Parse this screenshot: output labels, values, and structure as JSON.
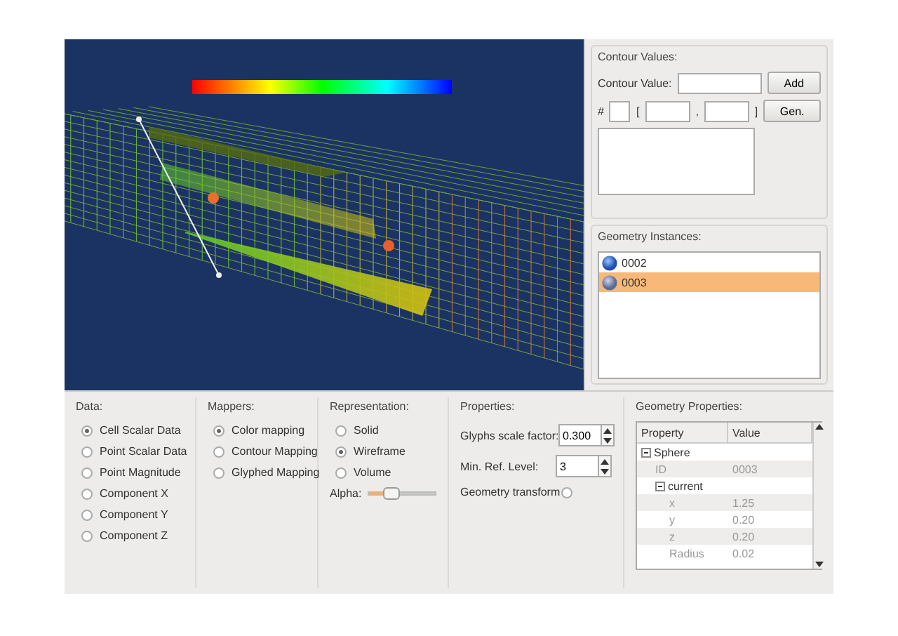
{
  "contour_values": {
    "title": "Contour Values:",
    "value_label": "Contour Value:",
    "add_button": "Add",
    "count_label": "#",
    "range_open": "[",
    "range_separator": ",",
    "range_close": "]",
    "gen_button": "Gen."
  },
  "geometry_instances": {
    "title": "Geometry Instances:",
    "items": [
      {
        "label": "0002",
        "selected": false
      },
      {
        "label": "0003",
        "selected": true
      }
    ]
  },
  "data": {
    "title": "Data:",
    "options": [
      {
        "label": "Cell Scalar Data",
        "selected": true
      },
      {
        "label": "Point Scalar Data",
        "selected": false
      },
      {
        "label": "Point Magnitude",
        "selected": false
      },
      {
        "label": "Component X",
        "selected": false
      },
      {
        "label": "Component Y",
        "selected": false
      },
      {
        "label": "Component Z",
        "selected": false
      }
    ]
  },
  "mappers": {
    "title": "Mappers:",
    "options": [
      {
        "label": "Color mapping",
        "selected": true
      },
      {
        "label": "Contour Mapping",
        "selected": false
      },
      {
        "label": "Glyphed Mapping",
        "selected": false
      }
    ]
  },
  "representation": {
    "title": "Representation:",
    "options": [
      {
        "label": "Solid",
        "selected": false
      },
      {
        "label": "Wireframe",
        "selected": true
      },
      {
        "label": "Volume",
        "selected": false
      }
    ],
    "alpha": {
      "label": "Alpha:",
      "level": 0.35
    }
  },
  "properties": {
    "title": "Properties:",
    "fields": [
      {
        "label": "Glyphs scale factor:",
        "value": "0.300"
      },
      {
        "label": "Min. Ref. Level:",
        "value": "3"
      }
    ],
    "transform": {
      "label": "Geometry transform",
      "checked": false
    }
  },
  "geometry_properties": {
    "title": "Geometry Properties:",
    "columns": [
      "Property",
      "Value"
    ],
    "rows": [
      {
        "property": "Sphere",
        "expanded": true,
        "children": [
          {
            "property": "ID",
            "value": "0003"
          },
          {
            "property": "current",
            "expanded": true,
            "children": [
              {
                "property": "x",
                "value": "1.25"
              },
              {
                "property": "y",
                "value": "0.20"
              },
              {
                "property": "z",
                "value": "0.20"
              },
              {
                "property": "Radius",
                "value": "0.02"
              }
            ]
          }
        ]
      }
    ]
  }
}
